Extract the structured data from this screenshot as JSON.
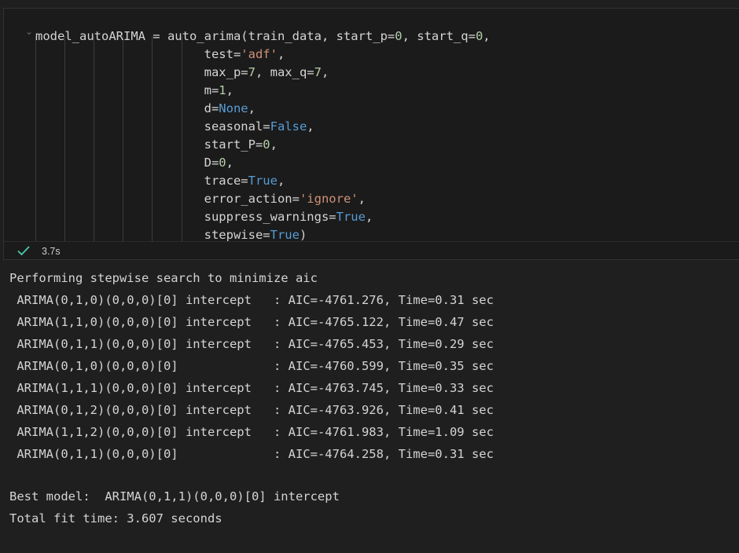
{
  "code_cell": {
    "lines": [
      [
        {
          "t": "model_autoARIMA = auto_arima(train_data, start_p=",
          "c": "plain"
        },
        {
          "t": "0",
          "c": "num"
        },
        {
          "t": ", start_q=",
          "c": "plain"
        },
        {
          "t": "0",
          "c": "num"
        },
        {
          "t": ",",
          "c": "plain"
        }
      ],
      [
        {
          "t": "                       test=",
          "c": "plain"
        },
        {
          "t": "'adf'",
          "c": "str"
        },
        {
          "t": ",",
          "c": "plain"
        }
      ],
      [
        {
          "t": "                       max_p=",
          "c": "plain"
        },
        {
          "t": "7",
          "c": "num"
        },
        {
          "t": ", max_q=",
          "c": "plain"
        },
        {
          "t": "7",
          "c": "num"
        },
        {
          "t": ",",
          "c": "plain"
        }
      ],
      [
        {
          "t": "                       m=",
          "c": "plain"
        },
        {
          "t": "1",
          "c": "num"
        },
        {
          "t": ",",
          "c": "plain"
        }
      ],
      [
        {
          "t": "                       d=",
          "c": "plain"
        },
        {
          "t": "None",
          "c": "kw"
        },
        {
          "t": ",",
          "c": "plain"
        }
      ],
      [
        {
          "t": "                       seasonal=",
          "c": "plain"
        },
        {
          "t": "False",
          "c": "kw"
        },
        {
          "t": ",",
          "c": "plain"
        }
      ],
      [
        {
          "t": "                       start_P=",
          "c": "plain"
        },
        {
          "t": "0",
          "c": "num"
        },
        {
          "t": ",",
          "c": "plain"
        }
      ],
      [
        {
          "t": "                       D=",
          "c": "plain"
        },
        {
          "t": "0",
          "c": "num"
        },
        {
          "t": ",",
          "c": "plain"
        }
      ],
      [
        {
          "t": "                       trace=",
          "c": "plain"
        },
        {
          "t": "True",
          "c": "kw"
        },
        {
          "t": ",",
          "c": "plain"
        }
      ],
      [
        {
          "t": "                       error_action=",
          "c": "plain"
        },
        {
          "t": "'ignore'",
          "c": "str"
        },
        {
          "t": ",",
          "c": "plain"
        }
      ],
      [
        {
          "t": "                       suppress_warnings=",
          "c": "plain"
        },
        {
          "t": "True",
          "c": "kw"
        },
        {
          "t": ",",
          "c": "plain"
        }
      ],
      [
        {
          "t": "                       stepwise=",
          "c": "plain"
        },
        {
          "t": "True",
          "c": "kw"
        },
        {
          "t": ")",
          "c": "plain"
        }
      ]
    ],
    "status": {
      "icon": "check-icon",
      "execution_time": "3.7s"
    }
  },
  "output": {
    "header": "Performing stepwise search to minimize aic",
    "rows": [
      {
        "model": " ARIMA(0,1,0)(0,0,0)[0] intercept   ",
        "aic": "-4761.276",
        "time": "0.31"
      },
      {
        "model": " ARIMA(1,1,0)(0,0,0)[0] intercept   ",
        "aic": "-4765.122",
        "time": "0.47"
      },
      {
        "model": " ARIMA(0,1,1)(0,0,0)[0] intercept   ",
        "aic": "-4765.453",
        "time": "0.29"
      },
      {
        "model": " ARIMA(0,1,0)(0,0,0)[0]             ",
        "aic": "-4760.599",
        "time": "0.35"
      },
      {
        "model": " ARIMA(1,1,1)(0,0,0)[0] intercept   ",
        "aic": "-4763.745",
        "time": "0.33"
      },
      {
        "model": " ARIMA(0,1,2)(0,0,0)[0] intercept   ",
        "aic": "-4763.926",
        "time": "0.41"
      },
      {
        "model": " ARIMA(1,1,2)(0,0,0)[0] intercept   ",
        "aic": "-4761.983",
        "time": "1.09"
      },
      {
        "model": " ARIMA(0,1,1)(0,0,0)[0]             ",
        "aic": "-4764.258",
        "time": "0.31"
      }
    ],
    "best_model_line": "Best model:  ARIMA(0,1,1)(0,0,0)[0] intercept",
    "total_time_line": "Total fit time: 3.607 seconds"
  },
  "colors": {
    "background": "#1f1f1f",
    "string": "#ce9178",
    "number": "#b5cea8",
    "keyword": "#569cd6",
    "check": "#4ec9b0"
  }
}
